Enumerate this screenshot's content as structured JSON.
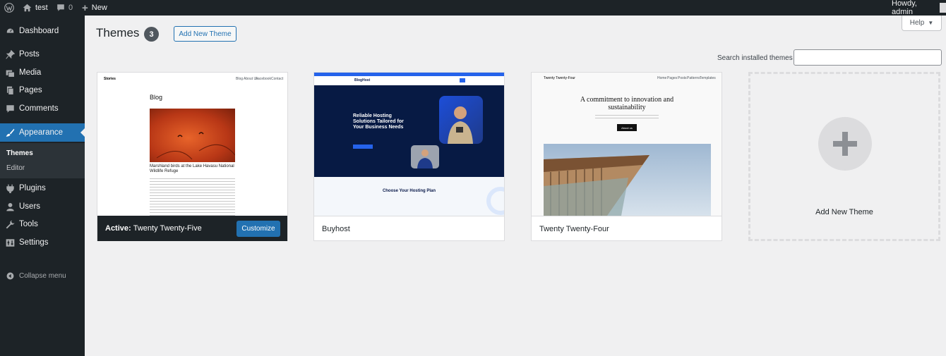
{
  "adminbar": {
    "site_name": "test",
    "comments_count": "0",
    "new_label": "New",
    "greeting": "Howdy, admin"
  },
  "sidebar": {
    "items": [
      {
        "label": "Dashboard",
        "icon": "dashboard-icon"
      },
      {
        "label": "Posts",
        "icon": "pin-icon"
      },
      {
        "label": "Media",
        "icon": "media-icon"
      },
      {
        "label": "Pages",
        "icon": "pages-icon"
      },
      {
        "label": "Comments",
        "icon": "comment-icon"
      },
      {
        "label": "Appearance",
        "icon": "brush-icon"
      },
      {
        "label": "Plugins",
        "icon": "plugin-icon"
      },
      {
        "label": "Users",
        "icon": "user-icon"
      },
      {
        "label": "Tools",
        "icon": "wrench-icon"
      },
      {
        "label": "Settings",
        "icon": "settings-icon"
      }
    ],
    "submenu": [
      {
        "label": "Themes"
      },
      {
        "label": "Editor"
      }
    ],
    "collapse_label": "Collapse menu"
  },
  "page": {
    "title": "Themes",
    "count": "3",
    "add_new_label": "Add New Theme",
    "help_label": "Help",
    "search_label": "Search installed themes",
    "search_value": ""
  },
  "themes": [
    {
      "name": "Twenty Twenty-Five",
      "active_prefix": "Active:",
      "customize_label": "Customize",
      "preview": {
        "site": "Stories",
        "nav": [
          "Blog",
          "About Us",
          "Facebook",
          "Contact"
        ],
        "heading": "Blog",
        "caption": "Marshland birds at the Lake Havasu National Wildlife Refuge"
      }
    },
    {
      "name": "Buyhost",
      "preview": {
        "logo": "BlogHost",
        "headline": "Reliable Hosting Solutions Tailored for Your Business Needs",
        "section": "Choose Your Hosting Plan"
      }
    },
    {
      "name": "Twenty Twenty-Four",
      "preview": {
        "site": "Twenty Twenty-Four",
        "nav": [
          "Home",
          "Pages",
          "Posts",
          "Patterns",
          "Templates"
        ],
        "headline": "A commitment to innovation and sustainability",
        "button": "About us"
      }
    }
  ],
  "add_theme_card": {
    "label": "Add New Theme"
  },
  "colors": {
    "accent": "#2271b1",
    "adminbar": "#1d2327",
    "submenu": "#2c3338",
    "background": "#f0f0f1"
  }
}
